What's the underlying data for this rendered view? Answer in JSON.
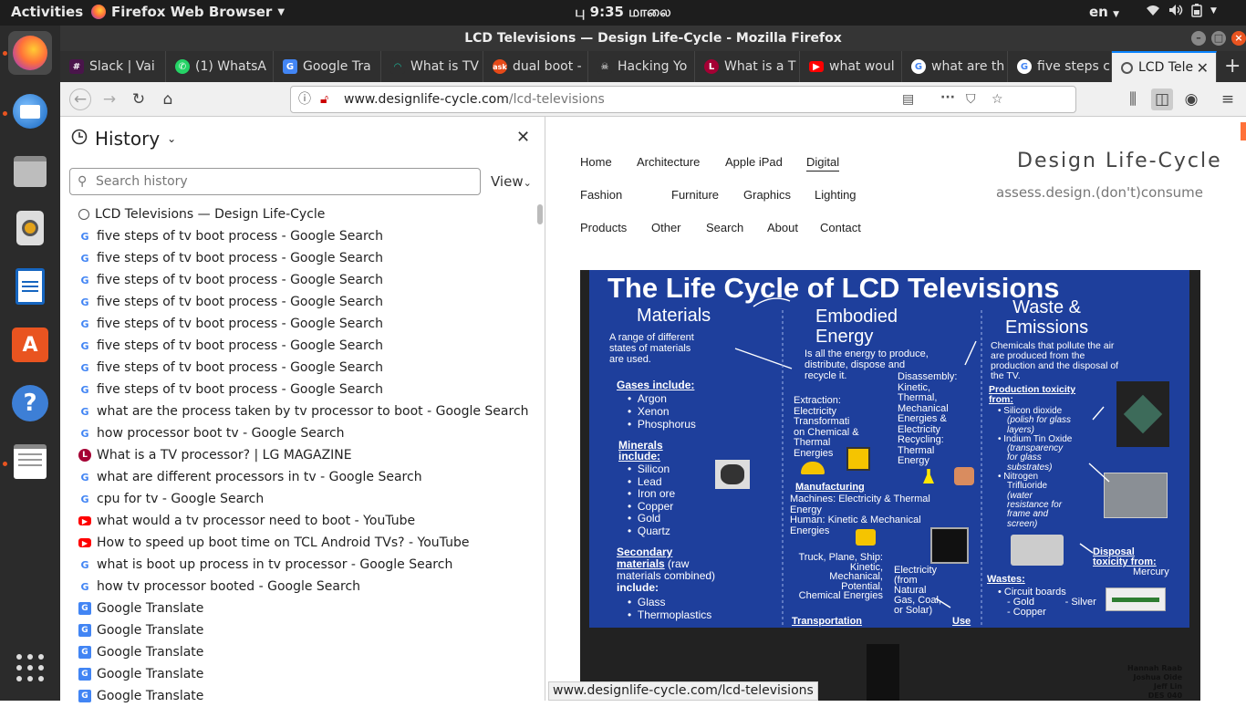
{
  "topbar": {
    "activities": "Activities",
    "app": "Firefox Web Browser",
    "clock": "பு 9:35 மாலை",
    "lang": "en"
  },
  "window": {
    "title": "LCD Televisions — Design Life-Cycle - Mozilla Firefox"
  },
  "tabs": [
    {
      "label": "Slack | Vai"
    },
    {
      "label": "(1) WhatsA"
    },
    {
      "label": "Google Tra"
    },
    {
      "label": "What is TV"
    },
    {
      "label": "dual boot -"
    },
    {
      "label": "Hacking Yo"
    },
    {
      "label": "What is a T"
    },
    {
      "label": "what woul"
    },
    {
      "label": "what are th"
    },
    {
      "label": "five steps c"
    },
    {
      "label": "LCD Tele"
    }
  ],
  "url": {
    "domain": "www.designlife-cycle.com",
    "path": "/lcd-televisions"
  },
  "sidebar": {
    "title": "History",
    "search_placeholder": "Search history",
    "view": "View",
    "items": [
      {
        "label": "LCD Televisions — Design Life-Cycle",
        "icon": "globe"
      },
      {
        "label": "five steps of tv boot process - Google Search",
        "icon": "google"
      },
      {
        "label": "five steps of tv boot process - Google Search",
        "icon": "google"
      },
      {
        "label": "five steps of tv boot process - Google Search",
        "icon": "google"
      },
      {
        "label": "five steps of tv boot process - Google Search",
        "icon": "google"
      },
      {
        "label": "five steps of tv boot process - Google Search",
        "icon": "google"
      },
      {
        "label": "five steps of tv boot process - Google Search",
        "icon": "google"
      },
      {
        "label": "five steps of tv boot process - Google Search",
        "icon": "google"
      },
      {
        "label": "five steps of tv boot process - Google Search",
        "icon": "google"
      },
      {
        "label": "what are the process taken by tv processor to boot - Google Search",
        "icon": "google"
      },
      {
        "label": "how processor boot tv - Google Search",
        "icon": "google"
      },
      {
        "label": "What is a TV processor? | LG MAGAZINE",
        "icon": "lg"
      },
      {
        "label": "what are different processors in tv - Google Search",
        "icon": "google"
      },
      {
        "label": "cpu for tv - Google Search",
        "icon": "google"
      },
      {
        "label": "what would a tv processor need to boot - YouTube",
        "icon": "youtube"
      },
      {
        "label": "How to speed up boot time on TCL Android TVs? - YouTube",
        "icon": "youtube"
      },
      {
        "label": "what is boot up process in tv processor - Google Search",
        "icon": "google"
      },
      {
        "label": "how tv processor booted - Google Search",
        "icon": "google"
      },
      {
        "label": "Google Translate",
        "icon": "translate"
      },
      {
        "label": "Google Translate",
        "icon": "translate"
      },
      {
        "label": "Google Translate",
        "icon": "translate"
      },
      {
        "label": "Google Translate",
        "icon": "translate"
      },
      {
        "label": "Google Translate",
        "icon": "translate"
      }
    ]
  },
  "site": {
    "menu": [
      "Home",
      "Architecture",
      "Apple iPad",
      "Digital",
      "Fashion",
      "Furniture",
      "Graphics",
      "Lighting",
      "Products",
      "Other",
      "Search",
      "About",
      "Contact"
    ],
    "name": "Design Life-Cycle",
    "tagline": "assess.design.(don't)consume"
  },
  "poster": {
    "title": "The Life Cycle of LCD Televisions",
    "materials_h": "Materials",
    "materials_intro": [
      "A range of different",
      "states of materials",
      "are used."
    ],
    "gases_h": "Gases include:",
    "gases": [
      "Argon",
      "Xenon",
      "Phosphorus"
    ],
    "minerals_h": [
      "Minerals",
      "include:"
    ],
    "minerals": [
      "Silicon",
      "Lead",
      "Iron ore",
      "Copper",
      "Gold",
      "Quartz"
    ],
    "secondary_h": [
      "Secondary",
      "materials"
    ],
    "secondary_rest": [
      "(raw",
      "materials combined)",
      "include:"
    ],
    "secondary": [
      "Glass",
      "Thermoplastics"
    ],
    "energy_h": [
      "Embodied",
      "Energy"
    ],
    "energy_intro": [
      "Is all the energy to produce,",
      "distribute, dispose and",
      "recycle it."
    ],
    "extraction": [
      "Extraction:",
      "Electricity",
      "Transformati",
      "on Chemical &",
      "Thermal",
      "Energies"
    ],
    "disassembly": [
      "Disassembly:",
      "Kinetic,",
      "Thermal,",
      "Mechanical",
      "Energies &",
      "Electricity",
      "Recycling:",
      "Thermal",
      "Energy"
    ],
    "manufacturing_h": "Manufacturing",
    "manufacturing": [
      "Machines: Electricity & Thermal",
      "Energy",
      "Human: Kinetic & Mechanical",
      "Energies"
    ],
    "transport": [
      "Truck, Plane, Ship:",
      "Kinetic,",
      "Mechanical,",
      "Potential,",
      "Chemical Energies"
    ],
    "transport_h": "Transportation",
    "use_energy": [
      "Electricity",
      "(from",
      "Natural",
      "Gas, Coal,",
      "or Solar)"
    ],
    "use_h": "Use",
    "waste_h": [
      "Waste &",
      "Emissions"
    ],
    "waste_intro": [
      "Chemicals that pollute the air",
      "are produced from the",
      "production and the disposal of",
      "the TV."
    ],
    "prod_tox_h": [
      "Production toxicity",
      "from:"
    ],
    "prod_tox": [
      "Silicon dioxide",
      "(polish for glass",
      "layers)",
      "Indium Tin Oxide",
      "(transparency",
      "for glass",
      "substrates)",
      "Nitrogen",
      "Trifluoride",
      "(water",
      "resistance for",
      "frame and",
      "screen)"
    ],
    "disp_tox_h": [
      "Disposal",
      "toxicity from:"
    ],
    "disp_tox": "Mercury",
    "wastes_h": "Wastes:",
    "wastes": [
      "Circuit boards",
      "- Gold",
      "- Silver",
      "- Copper"
    ],
    "credits": [
      "Hannah Raab",
      "Joshua Oide",
      "Jeff Lin",
      "DES 040"
    ]
  },
  "status": "www.designlife-cycle.com/lcd-televisions"
}
